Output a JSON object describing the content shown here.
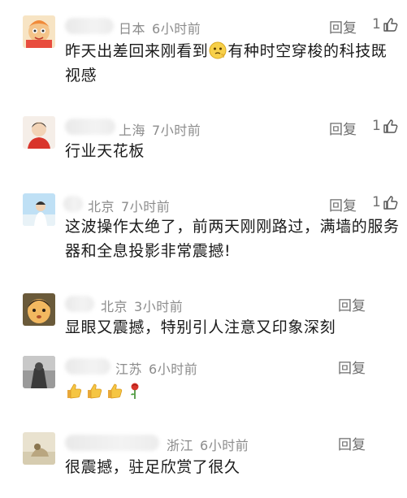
{
  "comments": [
    {
      "location": "日本",
      "time": "6小时前",
      "reply_label": "回复",
      "likes": "1",
      "text_part1": "昨天出差回来刚看到",
      "text_part2": "有种时空穿梭的科技既视感",
      "avatar": "cartoon-girl-avatar"
    },
    {
      "location": "上海",
      "time": "7小时前",
      "reply_label": "回复",
      "likes": "1",
      "text": "行业天花板",
      "avatar": "red-shirt-avatar"
    },
    {
      "location": "北京",
      "time": "7小时前",
      "reply_label": "回复",
      "likes": "1",
      "text": "这波操作太绝了，前两天刚刚路过，满墙的服务器和全息投影非常震撼!",
      "avatar": "sky-person-avatar"
    },
    {
      "location": "北京",
      "time": "3小时前",
      "reply_label": "回复",
      "text": "显眼又震撼，特别引人注意又印象深刻",
      "avatar": "round-face-avatar"
    },
    {
      "location": "江苏",
      "time": "6小时前",
      "reply_label": "回复",
      "emojis": [
        "thumbs-up",
        "thumbs-up",
        "thumbs-up",
        "rose"
      ],
      "avatar": "dark-figure-avatar"
    },
    {
      "location": "浙江",
      "time": "6小时前",
      "reply_label": "回复",
      "text": "很震撼，驻足欣赏了很久",
      "avatar": "beige-avatar"
    }
  ],
  "colors": {
    "meta": "#8c8c8c",
    "text": "#1a1a1a",
    "reply": "#6e6e6e"
  }
}
